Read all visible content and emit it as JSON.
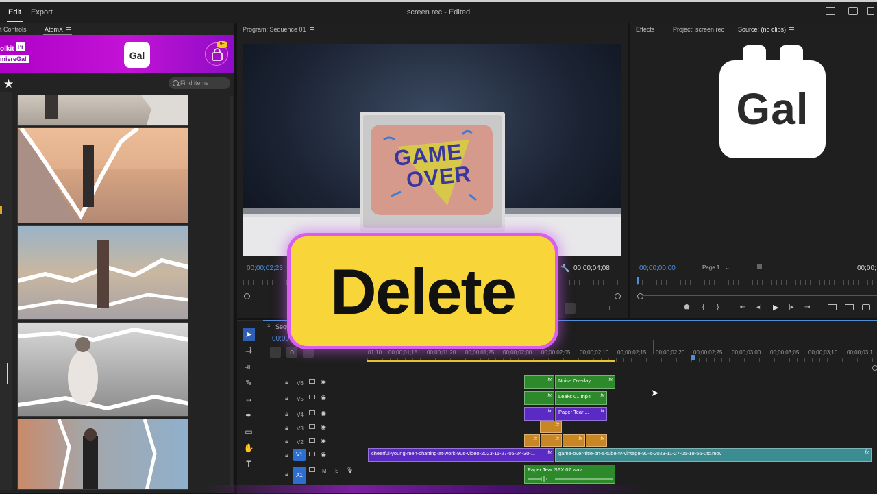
{
  "menu": {
    "edit": "Edit",
    "export": "Export"
  },
  "app_title": "screen rec - Edited",
  "left_panel": {
    "tab_controls": "t Controls",
    "tab_atomx": "AtomX",
    "brand_line1": "olkit",
    "brand_pr": "Pr",
    "brand_line2": "miereGal",
    "logo_text": "Gal",
    "badge": "9+",
    "search_placeholder": "Find items"
  },
  "program": {
    "tab": "Program: Sequence 01",
    "timecode_in": "00;00;02;23",
    "timecode_out": "00;00;04;08",
    "screen_text_1": "GAME",
    "screen_text_2": "OVER"
  },
  "source": {
    "tab_effects": "Effects",
    "tab_project": "Project: screen rec",
    "tab_source": "Source: (no clips)",
    "timecode": "00;00;00;00",
    "page": "Page 1",
    "timecode_right": "00;00;",
    "logo_text": "Gal"
  },
  "timeline": {
    "tab": "Seque",
    "timecode": "00;00",
    "ruler": [
      "01;10",
      "00;00;01;15",
      "00;00;01;20",
      "00;00;01;25",
      "00;00;02;00",
      "00;00;02;05",
      "00;00;02;10",
      "00;00;02;15",
      "00;00;02;20",
      "00;00;02;25",
      "00;00;03;00",
      "00;00;03;05",
      "00;00;03;10",
      "00;00;03;1"
    ],
    "tracks": [
      "V6",
      "V5",
      "V4",
      "V3",
      "V2",
      "V1",
      "A1"
    ],
    "a1_m": "M",
    "a1_s": "S",
    "clips": {
      "noise": "Noise Overlay...",
      "leaks": "Leaks 01.mp4",
      "paper": "Paper Tear ...",
      "v1_left": "cheerful-young-men-chatting-at-work-90s-video-2023-11-27-05-24-30-...",
      "v1_right": "game-over-title-on-a-tube-tv-vintage-90-s-2023-11-27-05-19-56-utc.mov",
      "audio": "Paper Tear SFX 07.wav",
      "fx": "fx"
    }
  },
  "overlay": {
    "delete": "Delete"
  },
  "colors": {
    "accent_blue": "#4f8ed8",
    "clip_green": "#2d8a2a",
    "clip_purple": "#5b2ac4",
    "clip_orange": "#c88625",
    "clip_teal": "#3b8d92",
    "badge_yellow": "#f8d63a",
    "atomx_magenta": "#c213d6"
  },
  "icons": [
    "star-icon",
    "search-icon",
    "bag-icon",
    "play-icon",
    "wrench-icon",
    "selection-tool-icon",
    "pen-tool-icon",
    "hand-tool-icon",
    "type-tool-icon",
    "lock-icon",
    "eye-icon",
    "mic-icon"
  ]
}
